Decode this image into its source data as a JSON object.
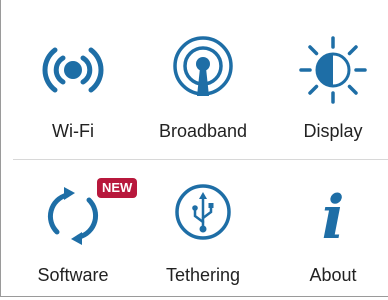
{
  "colors": {
    "icon": "#1e6ea6",
    "badge": "#b8183c",
    "text": "#222222"
  },
  "tiles": [
    {
      "id": "wifi",
      "label": "Wi-Fi",
      "icon": "wifi-signal-icon"
    },
    {
      "id": "broadband",
      "label": "Broadband",
      "icon": "broadband-antenna-icon"
    },
    {
      "id": "display",
      "label": "Display",
      "icon": "brightness-icon"
    },
    {
      "id": "software",
      "label": "Software",
      "icon": "update-arrows-icon",
      "badge": "NEW"
    },
    {
      "id": "tethering",
      "label": "Tethering",
      "icon": "usb-icon"
    },
    {
      "id": "about",
      "label": "About",
      "icon": "info-icon",
      "glyph": "i"
    }
  ]
}
